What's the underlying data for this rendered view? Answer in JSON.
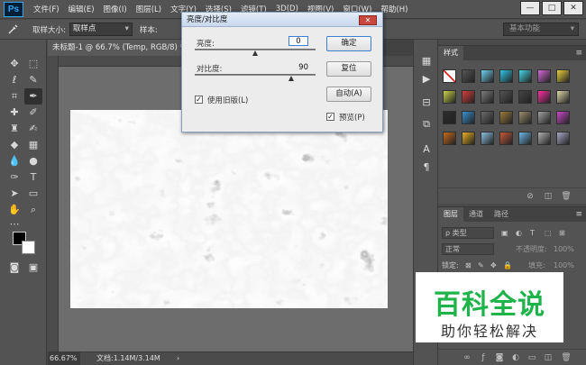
{
  "app": {
    "logo": "Ps"
  },
  "menubar": {
    "items": [
      "文件(F)",
      "编辑(E)",
      "图像(I)",
      "图层(L)",
      "文字(Y)",
      "选择(S)",
      "滤镜(T)",
      "3D(D)",
      "视图(V)",
      "窗口(W)",
      "帮助(H)"
    ],
    "window_buttons": [
      "—",
      "□",
      "✕"
    ]
  },
  "options_bar": {
    "tool_icon": "eyedropper-icon",
    "sample_size_label": "取样大小:",
    "sample_size_value": "取样点",
    "sample_label": "样本:",
    "workspace": "基本功能"
  },
  "document": {
    "tab_title": "未标题-1 @ 66.7% (Temp, RGB/8) *",
    "tab_close": "✕",
    "zoom": "66.67%",
    "doc_info": "文档:1.14M/3.14M",
    "status_arrow": "›"
  },
  "dialog": {
    "title": "亮度/对比度",
    "close": "✕",
    "brightness_label": "亮度:",
    "brightness_value": "0",
    "brightness_level": 0.5,
    "contrast_label": "对比度:",
    "contrast_value": "90",
    "contrast_level": 0.8,
    "use_legacy_label": "使用旧版(L)",
    "use_legacy_checked": "✓",
    "preview_label": "预览(P)",
    "preview_checked": "✓",
    "buttons": {
      "ok": "确定",
      "reset": "复位",
      "auto": "自动(A)"
    }
  },
  "styles_panel": {
    "tab": "样式",
    "menu": "≡",
    "swatches": [
      "#ffffff",
      "#555555",
      "#6fd3f0",
      "#2ec6e8",
      "#48d6e6",
      "#d46ad8",
      "#e8d040",
      "#c9d34a",
      "#d83c3c",
      "#7c7c7c",
      "#555555",
      "#444444",
      "#ff2fa0",
      "#dcd8a8",
      "#2c2c2c",
      "#3a8fd0",
      "#6a6a6a",
      "#9a7c3c",
      "#9a8e70",
      "#a0a0a0",
      "#c84ac8",
      "#c46a1c",
      "#e8b020",
      "#8cc0e0",
      "#c85838",
      "#6eb6e6",
      "#b0b0b0",
      "#a8a8c8"
    ]
  },
  "layers_panel": {
    "tabs": [
      "图层",
      "通道",
      "路径"
    ],
    "menu": "≡",
    "kind_label": "ρ 类型",
    "blend_mode": "正常",
    "opacity_label": "不透明度:",
    "opacity_value": "100%",
    "lock_label": "锁定:",
    "fill_label": "填充:",
    "fill_value": "100%"
  },
  "watermark": {
    "title": "百科全说",
    "subtitle": "助你轻松解决"
  }
}
